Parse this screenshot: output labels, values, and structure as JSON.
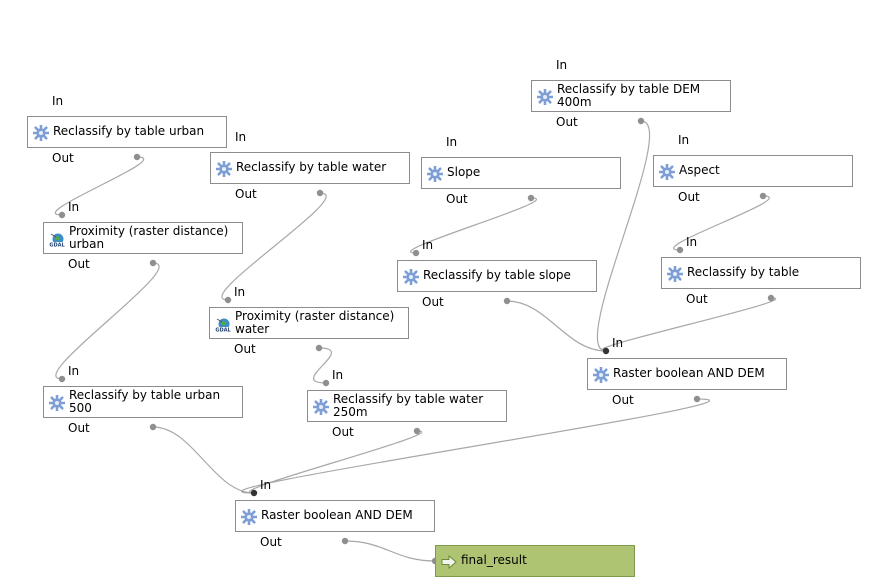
{
  "diagram": {
    "type": "processing-model",
    "port_labels": {
      "in": "In",
      "out": "Out"
    },
    "nodes": [
      {
        "id": "reclass-urban",
        "label": "Reclassify by table urban",
        "icon": "gear-icon"
      },
      {
        "id": "reclass-water",
        "label": "Reclassify by table water",
        "icon": "gear-icon"
      },
      {
        "id": "slope",
        "label": "Slope",
        "icon": "gear-icon"
      },
      {
        "id": "reclass-dem",
        "label": "Reclassify by table DEM\n400m",
        "icon": "gear-icon"
      },
      {
        "id": "aspect",
        "label": "Aspect",
        "icon": "gear-icon"
      },
      {
        "id": "prox-urban",
        "label": "Proximity (raster distance)\nurban",
        "icon": "gdal-icon"
      },
      {
        "id": "prox-water",
        "label": "Proximity (raster distance)\nwater",
        "icon": "gdal-icon"
      },
      {
        "id": "reclass-slope",
        "label": "Reclassify by table slope",
        "icon": "gear-icon"
      },
      {
        "id": "reclass-aspect",
        "label": "Reclassify by table",
        "icon": "gear-icon"
      },
      {
        "id": "reclass-urban-500",
        "label": "Reclassify by table urban\n500",
        "icon": "gear-icon"
      },
      {
        "id": "reclass-water-250",
        "label": "Reclassify by table water\n250m",
        "icon": "gear-icon"
      },
      {
        "id": "and-dem-1",
        "label": "Raster boolean AND DEM",
        "icon": "gear-icon"
      },
      {
        "id": "and-dem-2",
        "label": "Raster boolean AND DEM",
        "icon": "gear-icon"
      },
      {
        "id": "final",
        "label": "final_result",
        "icon": "output-arrow-icon"
      }
    ],
    "edges": [
      {
        "from": "reclass-urban",
        "to": "prox-urban"
      },
      {
        "from": "reclass-water",
        "to": "prox-water"
      },
      {
        "from": "slope",
        "to": "reclass-slope"
      },
      {
        "from": "aspect",
        "to": "reclass-aspect"
      },
      {
        "from": "prox-urban",
        "to": "reclass-urban-500"
      },
      {
        "from": "prox-water",
        "to": "reclass-water-250"
      },
      {
        "from": "reclass-dem",
        "to": "and-dem-1"
      },
      {
        "from": "reclass-slope",
        "to": "and-dem-1"
      },
      {
        "from": "reclass-aspect",
        "to": "and-dem-1"
      },
      {
        "from": "reclass-urban-500",
        "to": "and-dem-2"
      },
      {
        "from": "reclass-water-250",
        "to": "and-dem-2"
      },
      {
        "from": "and-dem-1",
        "to": "and-dem-2"
      },
      {
        "from": "and-dem-2",
        "to": "final"
      }
    ],
    "colors": {
      "node_border": "#8c8c8c",
      "output_fill": "#aec473",
      "gear": "#7d9fd6",
      "wire": "#a8a8a8",
      "port": "#8f8f8f",
      "port_active": "#333333"
    }
  }
}
